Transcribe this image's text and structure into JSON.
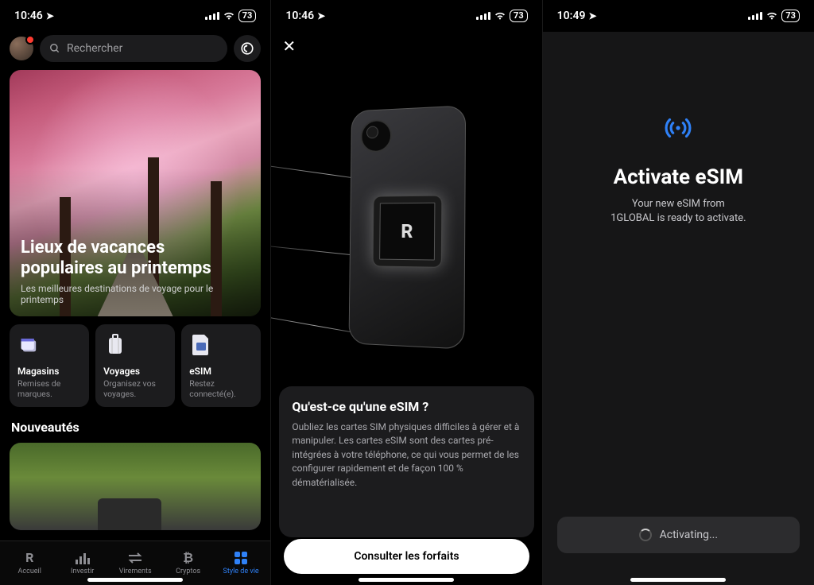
{
  "status": {
    "time1": "10:46",
    "time2": "10:46",
    "time3": "10:49",
    "battery": "73"
  },
  "screen1": {
    "search_placeholder": "Rechercher",
    "hero_title": "Lieux de vacances populaires au printemps",
    "hero_sub": "Les meilleures destinations de voyage pour le printemps",
    "tiles": [
      {
        "label": "Magasins",
        "desc": "Remises de marques."
      },
      {
        "label": "Voyages",
        "desc": "Organisez vos voyages."
      },
      {
        "label": "eSIM",
        "desc": "Restez connecté(e)."
      }
    ],
    "section_news": "Nouveautés",
    "tabs": {
      "home": "Accueil",
      "invest": "Investir",
      "transfers": "Virements",
      "crypto": "Cryptos",
      "lifestyle": "Style de vie"
    }
  },
  "screen2": {
    "chip_letter": "R",
    "title": "Qu'est-ce qu'une eSIM ?",
    "body": "Oubliez les cartes SIM physiques difficiles à gérer et à manipuler. Les cartes eSIM sont des cartes pré-intégrées à votre téléphone, ce qui vous permet de les configurer rapidement et de façon 100 % dématérialisée.",
    "cta": "Consulter les forfaits"
  },
  "screen3": {
    "title": "Activate eSIM",
    "sub_line1": "Your new eSIM from",
    "sub_line2": "1GLOBAL is ready to activate.",
    "activating": "Activating..."
  }
}
